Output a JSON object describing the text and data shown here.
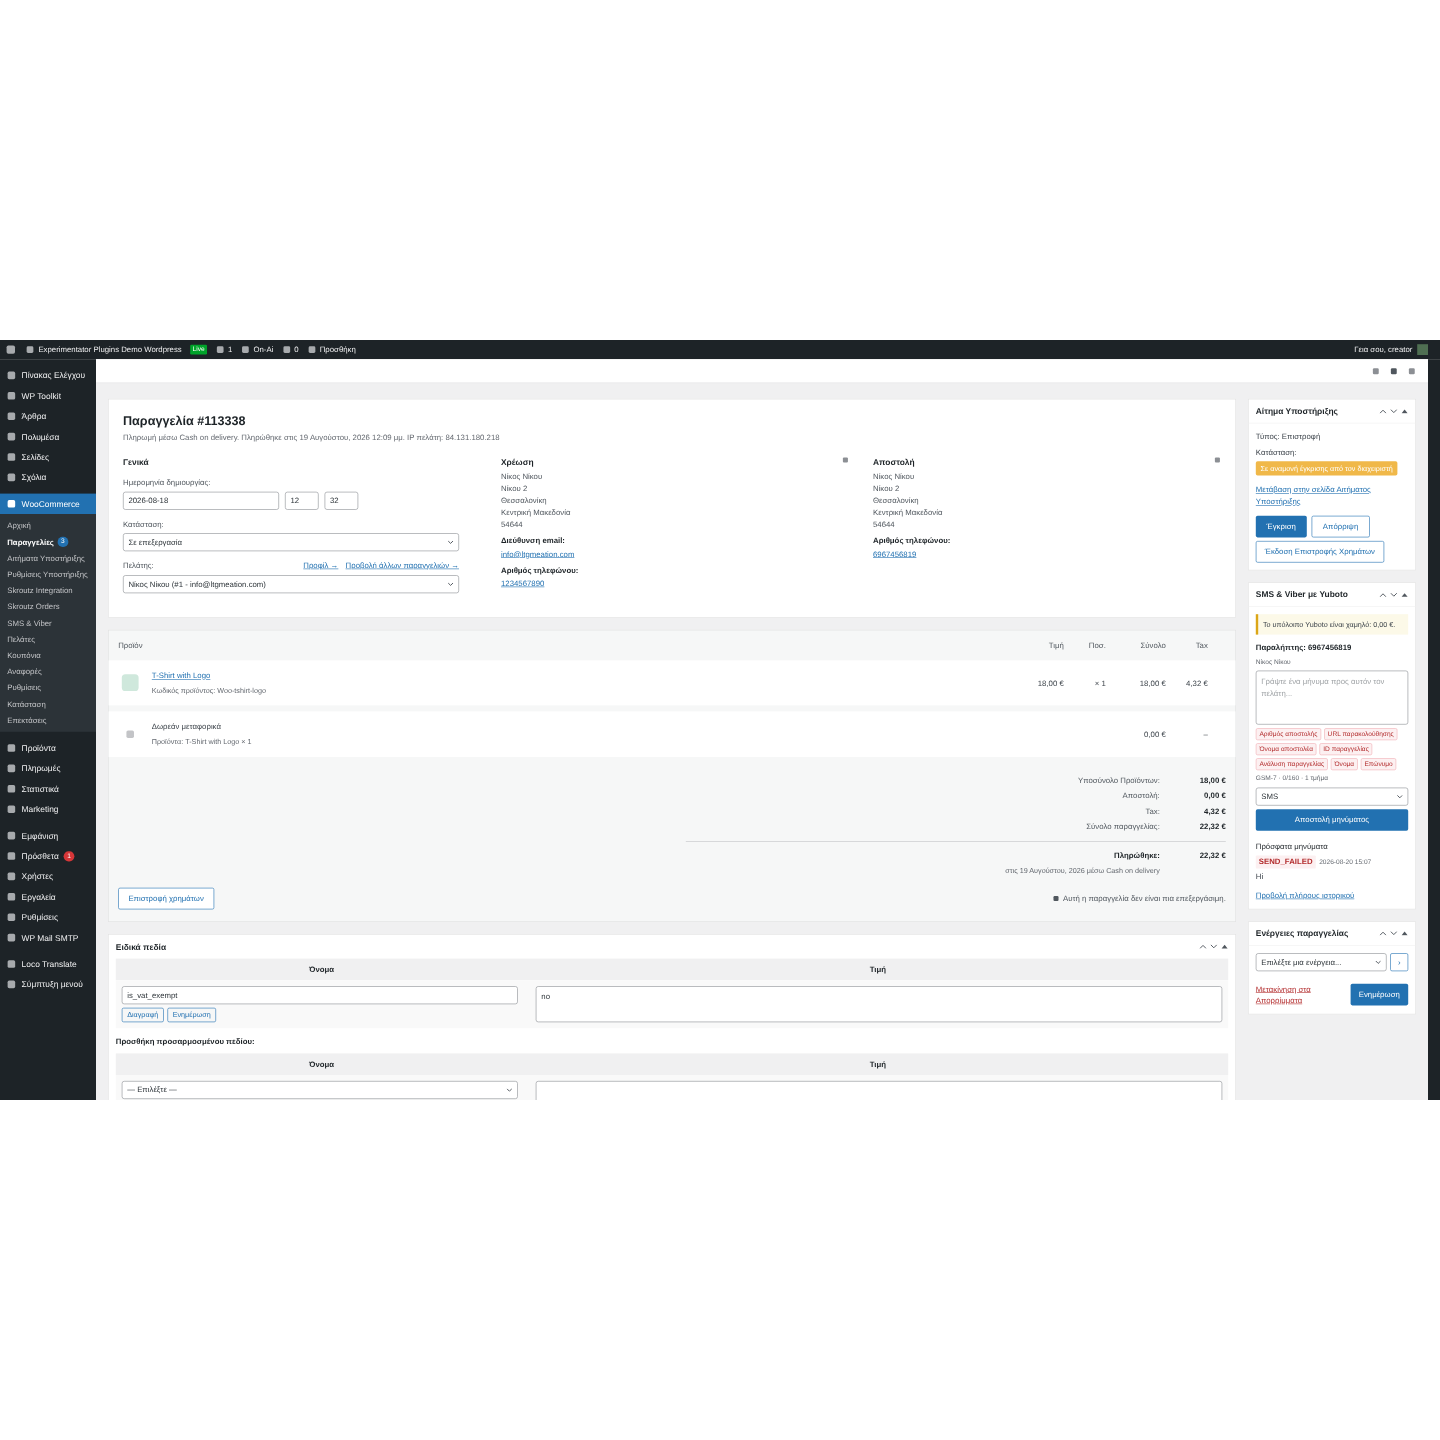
{
  "admin_bar": {
    "site_title": "Experimentator Plugins Demo Wordpress",
    "site_badge": "Live",
    "updates": "1",
    "search_label": "On-Ai",
    "comments": "0",
    "new_label": "Προσθήκη",
    "greeting": "Γεια σου, creator"
  },
  "sidebar": {
    "items": [
      {
        "label": "Πίνακας Ελέγχου",
        "selected": false
      },
      {
        "label": "WP Toolkit",
        "selected": false
      },
      {
        "label": "Άρθρα",
        "selected": false
      },
      {
        "label": "Πολυμέσα",
        "selected": false
      },
      {
        "label": "Σελίδες",
        "selected": false
      },
      {
        "label": "Σχόλια",
        "selected": false
      },
      {
        "label": "WooCommerce",
        "selected": true,
        "children": [
          {
            "label": "Αρχική",
            "selected": false
          },
          {
            "label": "Παραγγελίες",
            "selected": true,
            "badge": "3"
          },
          {
            "label": "Αιτήματα Υποστήριξης",
            "selected": false
          },
          {
            "label": "Ρυθμίσεις Υποστήριξης",
            "selected": false
          },
          {
            "label": "Skroutz Integration",
            "selected": false
          },
          {
            "label": "Skroutz Orders",
            "selected": false
          },
          {
            "label": "SMS & Viber",
            "selected": false
          },
          {
            "label": "Πελάτες",
            "selected": false
          },
          {
            "label": "Κουπόνια",
            "selected": false
          },
          {
            "label": "Αναφορές",
            "selected": false
          },
          {
            "label": "Ρυθμίσεις",
            "selected": false
          },
          {
            "label": "Κατάσταση",
            "selected": false
          },
          {
            "label": "Επεκτάσεις",
            "selected": false
          }
        ]
      },
      {
        "label": "Προϊόντα",
        "selected": false
      },
      {
        "label": "Πληρωμές",
        "selected": false
      },
      {
        "label": "Στατιστικά",
        "selected": false
      },
      {
        "label": "Marketing",
        "selected": false
      },
      {
        "label": "Εμφάνιση",
        "selected": false
      },
      {
        "label": "Πρόσθετα",
        "selected": false,
        "badge": "1"
      },
      {
        "label": "Χρήστες",
        "selected": false
      },
      {
        "label": "Εργαλεία",
        "selected": false
      },
      {
        "label": "Ρυθμίσεις",
        "selected": false
      },
      {
        "label": "WP Mail SMTP",
        "selected": false
      },
      {
        "label": "Loco Translate",
        "selected": false
      },
      {
        "label": "Σύμπτυξη μενού",
        "selected": false
      }
    ]
  },
  "order": {
    "title": "Παραγγελία #113338",
    "subtitle": "Πληρωμή μέσω Cash on delivery. Πληρώθηκε στις 19 Αυγούστου, 2026 12:09 μμ. IP πελάτη: 84.131.180.218",
    "general": {
      "heading": "Γενικά",
      "date_label": "Ημερομηνία δημιουργίας:",
      "date": "2026-08-18",
      "hour": "12",
      "minute": "32",
      "status_label": "Κατάσταση:",
      "status": "Σε επεξεργασία",
      "customer_label": "Πελάτης:",
      "profile_link": "Προφίλ →",
      "other_orders_link": "Προβολή άλλων παραγγελιών →",
      "customer": "Νίκος Νίκου (#1 - info@ltgmeation.com)"
    },
    "billing": {
      "heading": "Χρέωση",
      "address": [
        "Νίκος Νίκου",
        "Νίκου 2",
        "Θεσσαλονίκη",
        "Κεντρική Μακεδονία",
        "54644"
      ],
      "email_label": "Διεύθυνση email:",
      "email": "info@ltgmeation.com",
      "phone_label": "Αριθμός τηλεφώνου:",
      "phone": "1234567890"
    },
    "shipping": {
      "heading": "Αποστολή",
      "address": [
        "Νίκος Νίκου",
        "Νίκου 2",
        "Θεσσαλονίκη",
        "Κεντρική Μακεδονία",
        "54644"
      ],
      "phone_label": "Αριθμός τηλεφώνου:",
      "phone": "6967456819"
    }
  },
  "items": {
    "columns": [
      "Προϊόν",
      "Τιμή",
      "Ποσ.",
      "Σύνολο",
      "Tax"
    ],
    "rows": [
      {
        "kind": "product",
        "name": "T-Shirt with Logo",
        "meta": "Κωδικός προϊόντος: Woo-tshirt-logo",
        "price": "18,00 €",
        "qty": "× 1",
        "total": "18,00 €",
        "tax": "4,32 €"
      },
      {
        "kind": "shipping",
        "name": "Δωρεάν μεταφορικά",
        "meta": "Προϊόντα: T-Shirt with Logo × 1",
        "total": "0,00 €",
        "tax": "–"
      }
    ],
    "totals": [
      {
        "label": "Υποσύνολο Προϊόντων:",
        "value": "18,00 €"
      },
      {
        "label": "Αποστολή:",
        "value": "0,00 €"
      },
      {
        "label": "Tax:",
        "value": "4,32 €"
      },
      {
        "label": "Σύνολο παραγγελίας:",
        "value": "22,32 €"
      }
    ],
    "paid": {
      "label": "Πληρώθηκε:",
      "value": "22,32 €",
      "note": "στις 19 Αυγούστου, 2026 μέσω Cash on delivery"
    },
    "refund_button": "Επιστροφή χρημάτων",
    "locked_note": "Αυτή η παραγγελία δεν είναι πια επεξεργάσιμη."
  },
  "custom_fields": {
    "title": "Ειδικά πεδία",
    "columns": [
      "Όνομα",
      "Τιμή"
    ],
    "rows": [
      {
        "name": "is_vat_exempt",
        "value": "no",
        "buttons": [
          "Διαγραφή",
          "Ενημέρωση"
        ]
      }
    ],
    "add_label": "Προσθήκη προσαρμοσμένου πεδίου:",
    "add_columns": [
      "Όνομα",
      "Τιμή"
    ],
    "add_select": "— Επιλέξτε —"
  },
  "support_panel": {
    "title": "Αίτημα Υποστήριξης",
    "type": "Τύπος: Επιστροφή",
    "status_label": "Κατάσταση:",
    "status": "Σε αναμονή έγκρισης από τον διαχειριστή",
    "link": "Μετάβαση στην σελίδα Αιτήματος Υποστήριξης",
    "approve": "Έγκριση",
    "reject": "Απόρριψη",
    "refund": "Έκδοση Επιστροφής Χρημάτων"
  },
  "sms_panel": {
    "title": "SMS & Viber με Yuboto",
    "notice": "Το υπόλοιπο Yuboto είναι χαμηλό: 0,00 €.",
    "recipient": "Παραλήπτης: 6967456819",
    "recipient_sub": "Νίκος Νίκου",
    "placeholder": "Γράψτε ένα μήνυμα προς αυτόν τον πελάτη...",
    "tags": [
      "Αριθμός αποστολής",
      "URL παρακολούθησης",
      "Όνομα αποστολέα",
      "ID παραγγελίας",
      "Ανάλυση παραγγελίας",
      "Όνομα",
      "Επώνυμο"
    ],
    "counter": "GSM-7 · 0/160 · 1 τμήμα",
    "channel": "SMS",
    "send": "Αποστολή μηνύματος",
    "recent_title": "Πρόσφατα μηνύματα",
    "recent": [
      {
        "status": "SEND_FAILED",
        "time": "2026-08-20 15:07",
        "text": "Hi"
      }
    ],
    "history_link": "Προβολή πλήρους ιστορικού"
  },
  "actions_panel": {
    "title": "Ενέργειες παραγγελίας",
    "select": "Επιλέξτε μια ενέργεια...",
    "go": "›",
    "trash": "Μετακίνηση στα Απορρίμματα",
    "update": "Ενημέρωση"
  }
}
